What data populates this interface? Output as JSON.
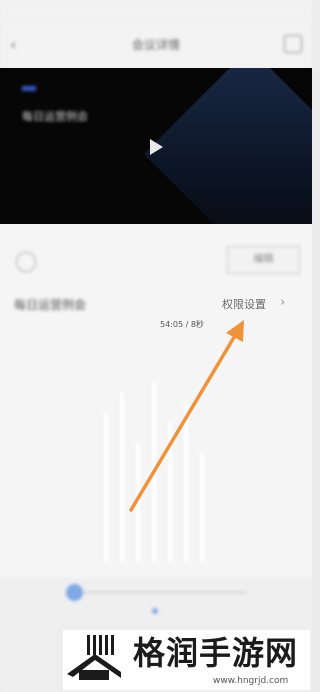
{
  "status_bar": {
    "time": "",
    "icons": ""
  },
  "header": {
    "title": "会议详情"
  },
  "video": {
    "title": "每日运营例会",
    "meta_line1": "",
    "meta_line2": ""
  },
  "toolbar": {
    "edit_label": "编辑"
  },
  "meeting": {
    "title": "每日运营例会",
    "subtitle": "",
    "duration": "54:05 / 8秒",
    "permission_label": "权限设置",
    "placeholder": ""
  },
  "player": {
    "start_time": "",
    "end_time": "",
    "progress": 0.0
  },
  "watermark": {
    "brand": "格润手游网",
    "url": "www.hngrjd.com"
  },
  "annotation": {
    "arrow_color": "#f0923a"
  }
}
